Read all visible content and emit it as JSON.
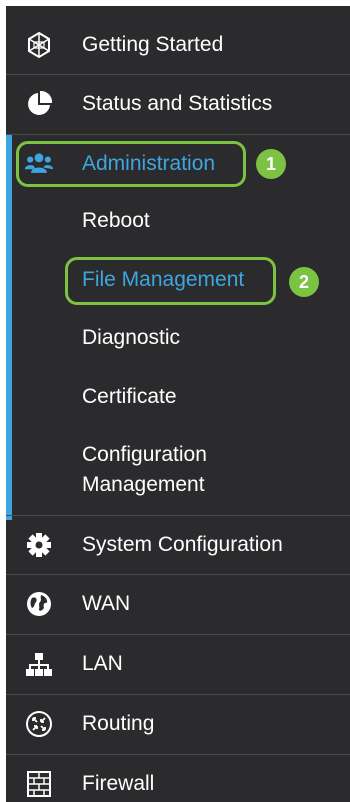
{
  "menu": {
    "getting_started": {
      "label": "Getting Started",
      "icon": "getting-started-icon"
    },
    "status": {
      "label": "Status and Statistics",
      "icon": "pie-chart-icon"
    },
    "administration": {
      "label": "Administration",
      "icon": "users-icon",
      "badge": "1",
      "children": {
        "reboot": "Reboot",
        "file_management": "File Management",
        "file_management_badge": "2",
        "diagnostic": "Diagnostic",
        "certificate": "Certificate",
        "configuration_management_line1": "Configuration",
        "configuration_management_line2": "Management"
      }
    },
    "system_configuration": {
      "label": "System Configuration",
      "icon": "gear-icon"
    },
    "wan": {
      "label": "WAN",
      "icon": "globe-icon"
    },
    "lan": {
      "label": "LAN",
      "icon": "network-icon"
    },
    "routing": {
      "label": "Routing",
      "icon": "routing-icon"
    },
    "firewall": {
      "label": "Firewall",
      "icon": "firewall-icon"
    }
  },
  "colors": {
    "background": "#2b2b2d",
    "active": "#3ea6df",
    "highlight": "#7cc243",
    "text": "#ffffff"
  }
}
